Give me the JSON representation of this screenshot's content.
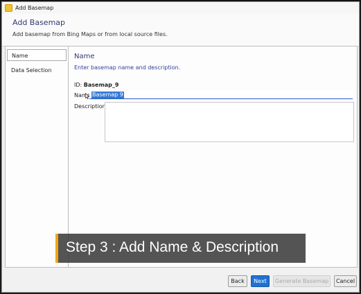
{
  "window": {
    "title": "Add Basemap",
    "icon": "app-icon"
  },
  "header": {
    "title": "Add Basemap",
    "subtitle": "Add basemap from Bing Maps or from local source files."
  },
  "sidebar": {
    "items": [
      {
        "label": "Name",
        "active": true
      },
      {
        "label": "Data Selection",
        "active": false
      }
    ]
  },
  "main": {
    "section_title": "Name",
    "section_subtitle": "Enter basemap name and description.",
    "id_label": "ID:",
    "id_value": "Basemap_9",
    "name_label": "Name",
    "name_value": "Basemap 9",
    "description_label": "Description",
    "description_value": ""
  },
  "buttons": {
    "back": "Back",
    "next": "Next",
    "generate": "Generate Basemap",
    "cancel": "Cancel"
  },
  "caption": {
    "text": "Step 3 : Add Name & Description"
  },
  "colors": {
    "accent": "#1f72d2",
    "heading": "#303a73",
    "caption_bar": "#f2a414"
  }
}
